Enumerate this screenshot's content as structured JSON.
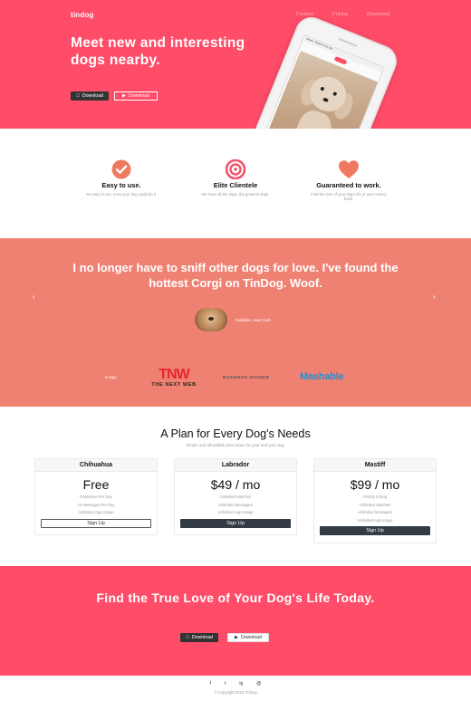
{
  "brand": "tindog",
  "nav": [
    "Contact",
    "Pricing",
    "Download"
  ],
  "hero": {
    "title": "Meet new and interesting dogs nearby.",
    "download_apple": "Download",
    "download_play": "Download"
  },
  "phone": {
    "status_left": "●●●●○ Sketch",
    "status_time": "9:41 AM"
  },
  "features": [
    {
      "icon": "check-circle-icon",
      "title": "Easy to use.",
      "desc": "So easy to use, even your dog could do it."
    },
    {
      "icon": "bullseye-icon",
      "title": "Elite Clientele",
      "desc": "We have all the dogs, the greatest dogs."
    },
    {
      "icon": "heart-icon",
      "title": "Guaranteed to work.",
      "desc": "Find the love of your dog's life or your money back."
    }
  ],
  "testimonial": {
    "quote": "I no longer have to sniff other dogs for love. I've found the hottest Corgi on TinDog. Woof.",
    "author": "Pebbles, New York",
    "prev": "‹",
    "next": "›"
  },
  "press": {
    "img_alt": "tc-logo",
    "tnw_logo": "TNW",
    "tnw_sub": "THE NEXT WEB",
    "bi": "BUSINESS INSIDER",
    "mashable": "Mashable"
  },
  "pricing": {
    "title": "A Plan for Every Dog's Needs",
    "subtitle": "Simple and affordable price plans for your and your dog.",
    "plans": [
      {
        "name": "Chihuahua",
        "price": "Free",
        "features": [
          "5 Matches Per Day",
          "10 Messages Per Day",
          "Unlimited App Usage"
        ],
        "button": "Sign Up"
      },
      {
        "name": "Labrador",
        "price": "$49 / mo",
        "features": [
          "Unlimited Matches",
          "Unlimited Messages",
          "Unlimited App Usage"
        ],
        "button": "Sign Up"
      },
      {
        "name": "Mastiff",
        "price": "$99 / mo",
        "features": [
          "Priority Listing",
          "Unlimited Matches",
          "Unlimited Messages",
          "Unlimited App Usage"
        ],
        "button": "Sign Up"
      }
    ]
  },
  "cta": {
    "title": "Find the True Love of Your Dog's Life Today.",
    "download_apple": "Download",
    "download_play": "Download"
  },
  "footer": {
    "socials": [
      "f",
      "t",
      "ig",
      "@"
    ],
    "copyright": "© Copyright 2018 TinDog"
  },
  "colors": {
    "primary": "#ff4c68",
    "testimonial_bg": "#ef8172",
    "dark_button": "#333b44",
    "mashable_blue": "#1e8fd9",
    "tnw_red": "#e8262e"
  }
}
